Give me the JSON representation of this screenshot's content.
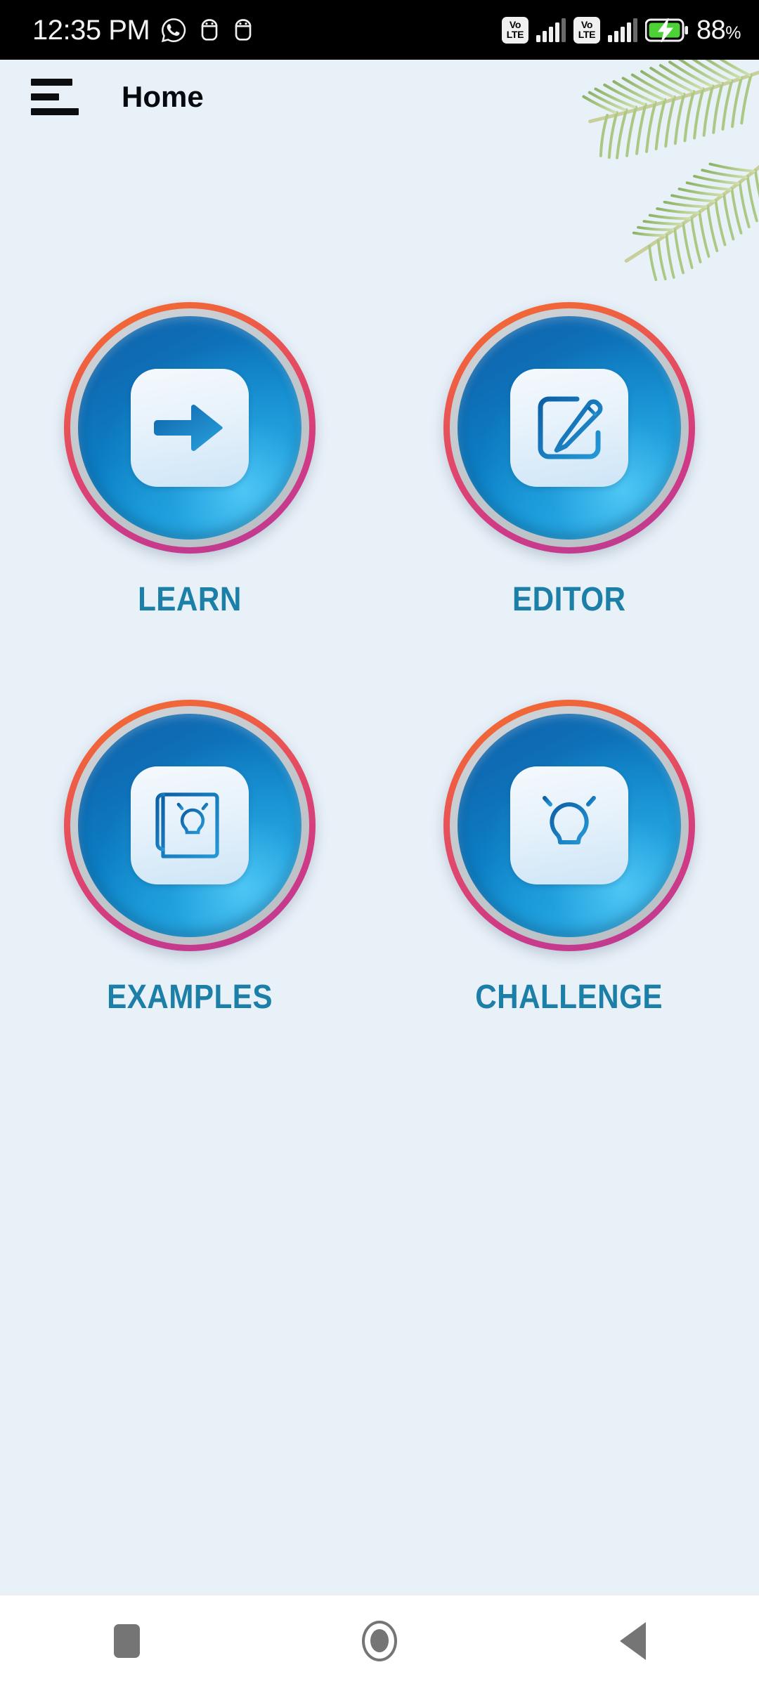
{
  "status_bar": {
    "time": "12:35 PM",
    "left_icons": [
      "whatsapp-icon",
      "android-app-icon",
      "android-app-icon"
    ],
    "network": [
      {
        "badge_top": "Vo",
        "badge_bottom": "LTE",
        "signal_bars": 4
      },
      {
        "badge_top": "Vo",
        "badge_bottom": "LTE",
        "signal_bars": 4
      }
    ],
    "battery": {
      "percent": "88",
      "percent_symbol": "%",
      "charging": true,
      "fill_color": "#4cd137"
    },
    "background": "#000000"
  },
  "app_bar": {
    "menu_icon": "hamburger-menu-icon",
    "title": "Home"
  },
  "theme": {
    "page_background": "#e8f0f8",
    "label_color": "#1b7fa8",
    "ring_top_color": "#f2702b",
    "ring_bottom_color": "#b93b96",
    "ring_mid_color": "#c8cdd2",
    "disc_blue_dark": "#1064ab",
    "disc_blue_light": "#2fb4e8",
    "glyph_plate": "#e7f2fb",
    "nav_bar_background": "#ffffff",
    "nav_icon_color": "#757575"
  },
  "decoration": {
    "name": "palm-leaf-decoration",
    "colors": [
      "#9bbd73",
      "#b8cf92",
      "#cfe0ae"
    ]
  },
  "grid": {
    "tiles": [
      {
        "id": "learn",
        "label": "LEARN",
        "icon": "arrow-right-icon"
      },
      {
        "id": "editor",
        "label": "EDITOR",
        "icon": "pencil-edit-icon"
      },
      {
        "id": "examples",
        "label": "EXAMPLES",
        "icon": "book-lightbulb-icon"
      },
      {
        "id": "challenge",
        "label": "CHALLENGE",
        "icon": "lightbulb-icon"
      }
    ]
  },
  "nav_bar": {
    "buttons": [
      {
        "id": "recents",
        "icon": "square-recents-icon"
      },
      {
        "id": "home",
        "icon": "circle-home-icon"
      },
      {
        "id": "back",
        "icon": "triangle-back-icon"
      }
    ]
  }
}
